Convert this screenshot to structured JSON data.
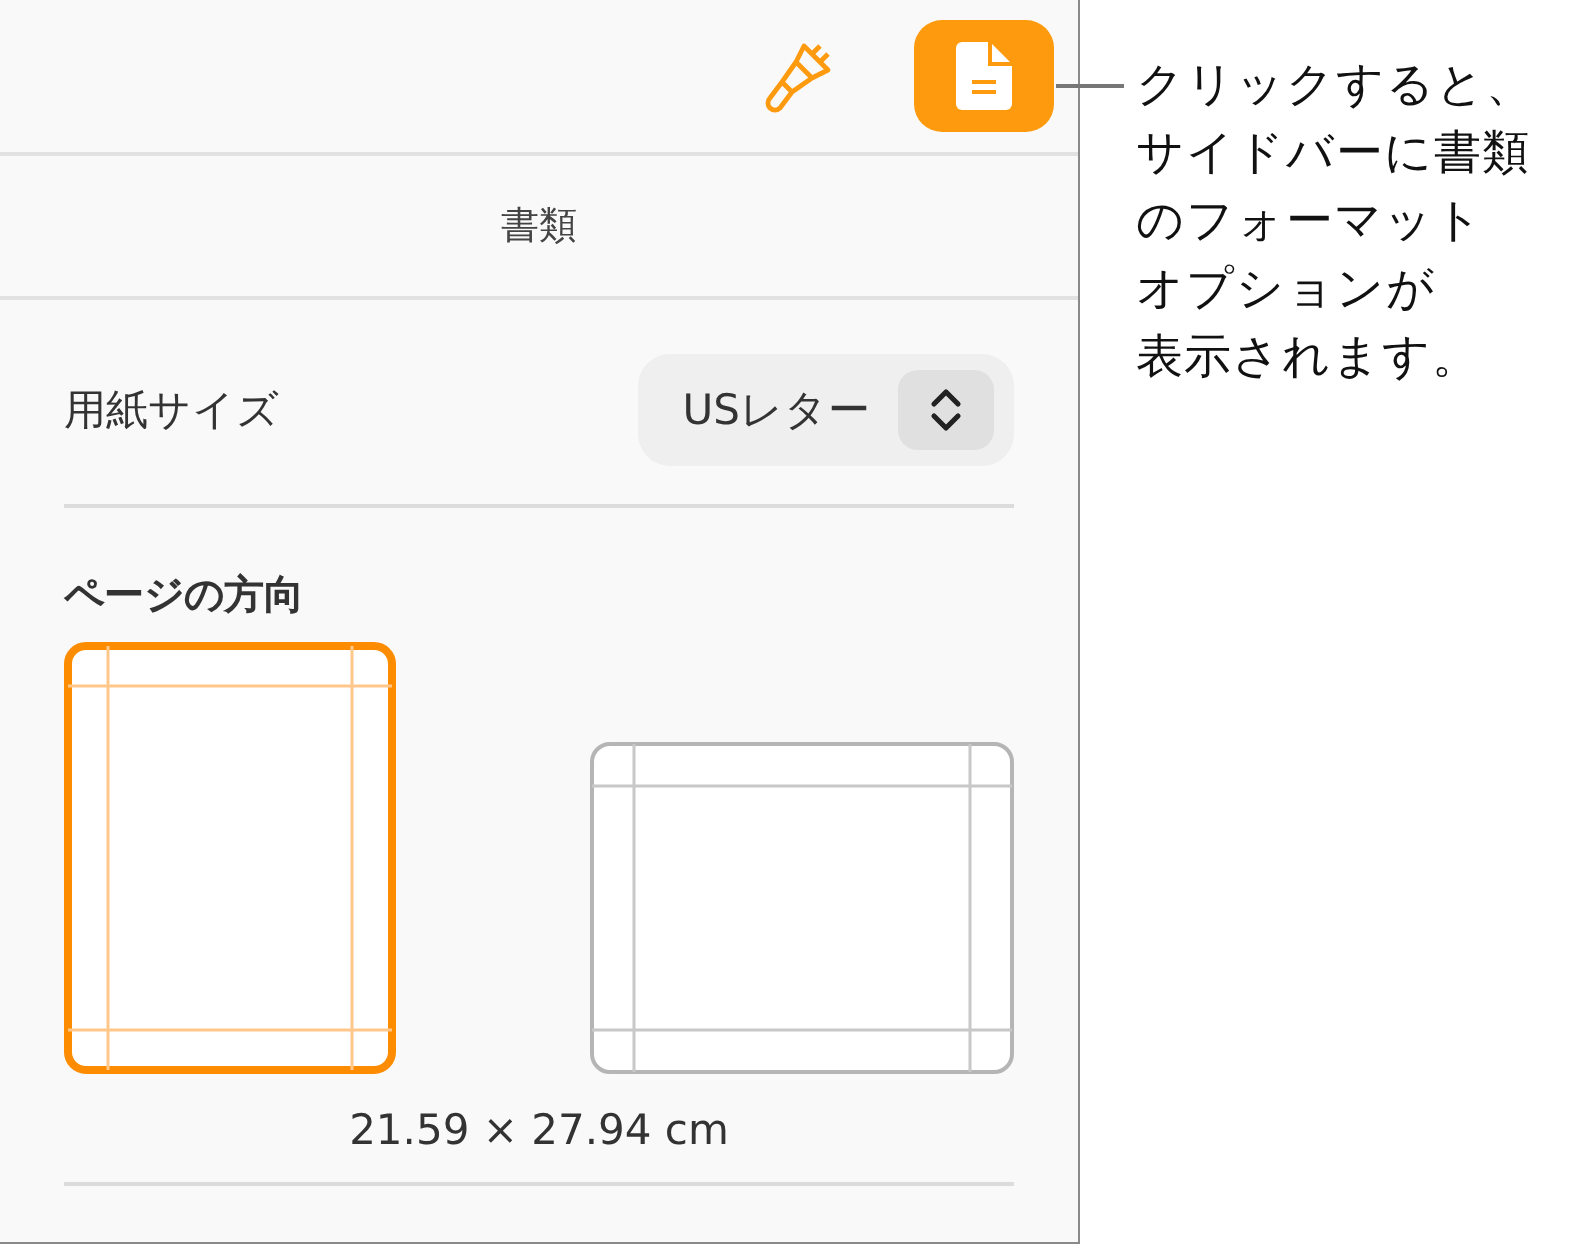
{
  "toolbar": {
    "buttons": [
      {
        "kind": "format",
        "selected": false
      },
      {
        "kind": "document",
        "selected": true
      }
    ]
  },
  "panel_title": "書類",
  "paper_size": {
    "label": "用紙サイズ",
    "value": "USレター"
  },
  "orientation": {
    "heading": "ページの方向",
    "options": [
      {
        "kind": "portrait",
        "selected": true
      },
      {
        "kind": "landscape",
        "selected": false
      }
    ],
    "dimensions": "21.59 × 27.94 cm"
  },
  "callout": {
    "lines": [
      "クリックすると、",
      "サイドバーに書類",
      "のフォーマット",
      "オプションが",
      "表示されます。"
    ]
  }
}
